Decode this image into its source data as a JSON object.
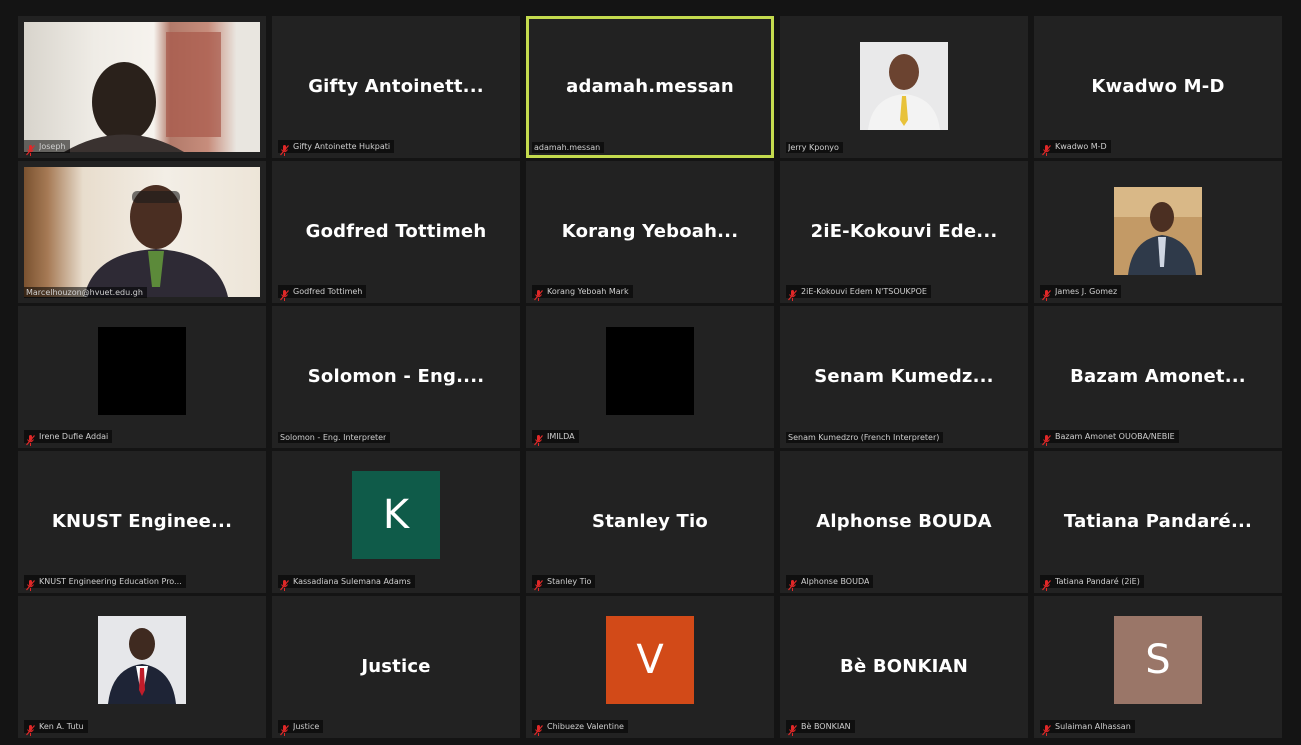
{
  "colors": {
    "active_outline": "#c4db4e",
    "mute_red": "#e02828",
    "tile_bg": "#222222",
    "avatar_k": "#0f5b49",
    "avatar_v": "#d24a18",
    "avatar_s": "#9a7668"
  },
  "tiles": [
    {
      "display_name": "",
      "label": "Joseph",
      "muted": true,
      "kind": "video"
    },
    {
      "display_name": "Gifty  Antoinett...",
      "label": "Gifty Antoinette Hukpati",
      "muted": true,
      "kind": "name"
    },
    {
      "display_name": "adamah.messan",
      "label": "adamah.messan",
      "muted": false,
      "kind": "name",
      "active": true
    },
    {
      "display_name": "",
      "label": "Jerry Kponyo",
      "muted": false,
      "kind": "photo"
    },
    {
      "display_name": "Kwadwo M-D",
      "label": "Kwadwo M-D",
      "muted": true,
      "kind": "name"
    },
    {
      "display_name": "",
      "label": "Marcelhouzon@hvuet.edu.gh",
      "muted": false,
      "kind": "video"
    },
    {
      "display_name": "Godfred Tottimeh",
      "label": "Godfred Tottimeh",
      "muted": true,
      "kind": "name"
    },
    {
      "display_name": "Korang  Yeboah...",
      "label": "Korang Yeboah Mark",
      "muted": true,
      "kind": "name"
    },
    {
      "display_name": "2iE-Kokouvi  Ede...",
      "label": "2iE-Kokouvi Edem N'TSOUKPOE",
      "muted": true,
      "kind": "name"
    },
    {
      "display_name": "",
      "label": "James J. Gomez",
      "muted": true,
      "kind": "photo"
    },
    {
      "display_name": "",
      "label": "Irene Dufie Addai",
      "muted": true,
      "kind": "black"
    },
    {
      "display_name": "Solomon  -  Eng....",
      "label": "Solomon - Eng. Interpreter",
      "muted": false,
      "kind": "name"
    },
    {
      "display_name": "",
      "label": "IMILDA",
      "muted": true,
      "kind": "black"
    },
    {
      "display_name": "Senam  Kumedz...",
      "label": "Senam Kumedzro (French Interpreter)",
      "muted": false,
      "kind": "name"
    },
    {
      "display_name": "Bazam  Amonet...",
      "label": "Bazam Amonet OUOBA/NEBIE",
      "muted": true,
      "kind": "name"
    },
    {
      "display_name": "KNUST  Enginee...",
      "label": "KNUST Engineering Education Pro...",
      "muted": true,
      "kind": "name"
    },
    {
      "display_name": "",
      "label": "Kassadiana Sulemana Adams",
      "muted": true,
      "kind": "letter",
      "letter": "K"
    },
    {
      "display_name": "Stanley Tio",
      "label": "Stanley Tio",
      "muted": true,
      "kind": "name"
    },
    {
      "display_name": "Alphonse BOUDA",
      "label": "Alphonse BOUDA",
      "muted": true,
      "kind": "name"
    },
    {
      "display_name": "Tatiana  Pandaré...",
      "label": "Tatiana Pandaré (2iE)",
      "muted": true,
      "kind": "name"
    },
    {
      "display_name": "",
      "label": "Ken A. Tutu",
      "muted": true,
      "kind": "photo"
    },
    {
      "display_name": "Justice",
      "label": "Justice",
      "muted": true,
      "kind": "name"
    },
    {
      "display_name": "",
      "label": "Chibueze Valentine",
      "muted": true,
      "kind": "letter",
      "letter": "V"
    },
    {
      "display_name": "Bè BONKIAN",
      "label": "Bè BONKIAN",
      "muted": true,
      "kind": "name"
    },
    {
      "display_name": "",
      "label": "Sulaiman Alhassan",
      "muted": true,
      "kind": "letter",
      "letter": "S"
    }
  ]
}
